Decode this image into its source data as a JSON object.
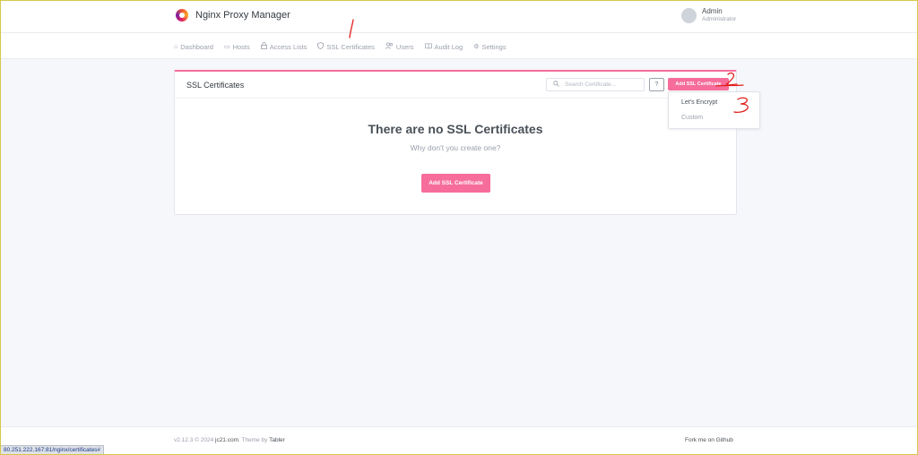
{
  "app": {
    "name": "Nginx Proxy Manager"
  },
  "user": {
    "name": "Admin",
    "role": "Administrator"
  },
  "nav": {
    "items": [
      {
        "label": "Dashboard",
        "icon": "home-icon"
      },
      {
        "label": "Hosts",
        "icon": "monitor-icon"
      },
      {
        "label": "Access Lists",
        "icon": "lock-icon"
      },
      {
        "label": "SSL Certificates",
        "icon": "shield-icon"
      },
      {
        "label": "Users",
        "icon": "users-icon"
      },
      {
        "label": "Audit Log",
        "icon": "book-icon"
      },
      {
        "label": "Settings",
        "icon": "gear-icon"
      }
    ]
  },
  "card": {
    "title": "SSL Certificates",
    "search_placeholder": "Search Certificate...",
    "help_label": "?",
    "add_button_label": "Add SSL Certificate",
    "empty_title": "There are no SSL Certificates",
    "empty_subtitle": "Why don't you create one?",
    "empty_button_label": "Add SSL Certificate"
  },
  "dropdown": {
    "items": [
      "Let's Encrypt",
      "Custom"
    ]
  },
  "annotations": [
    "1",
    "2",
    "3"
  ],
  "footer": {
    "version_prefix": "v2.12.3 © 2024 ",
    "company": "jc21.com",
    "theme_prefix": ". Theme by ",
    "theme": "Tabler",
    "github_link": "Fork me on Github"
  },
  "status_bar": {
    "url": "80.251.222.167:81/nginx/certificates#"
  },
  "colors": {
    "accent": "#f66d9b",
    "annotation": "#e0201c",
    "background": "#f5f7fb"
  }
}
